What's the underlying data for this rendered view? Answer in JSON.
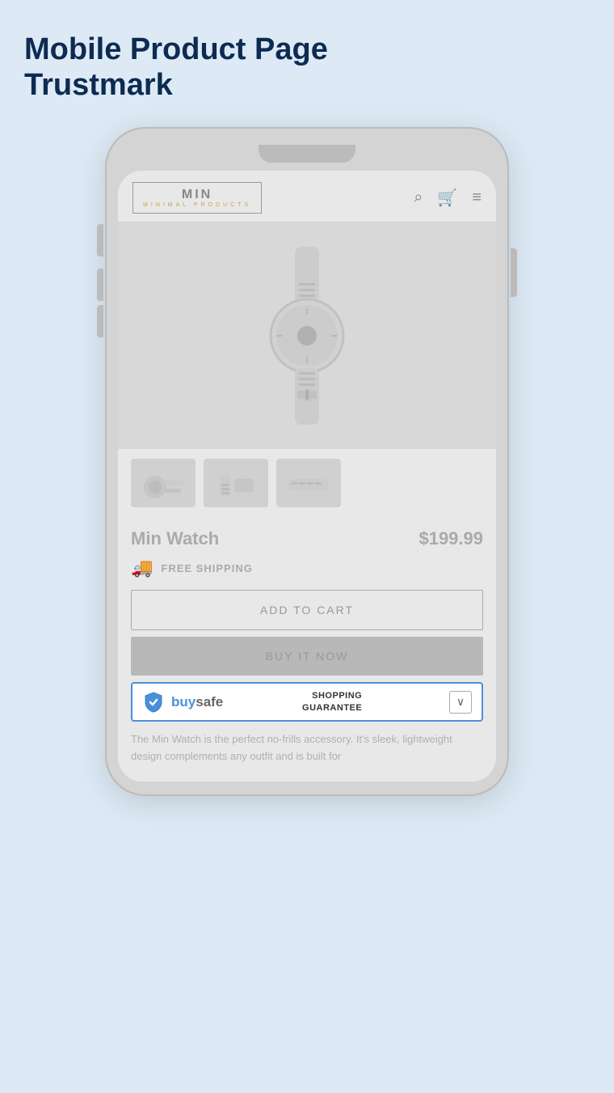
{
  "page": {
    "title_line1": "Mobile Product Page",
    "title_line2": "Trustmark"
  },
  "navbar": {
    "brand_name": "MIN",
    "brand_sub": "MINIMAL PRODUCTS",
    "search_icon": "⌕",
    "cart_icon": "🛒",
    "menu_icon": "≡"
  },
  "product": {
    "name": "Min Watch",
    "price": "$199.99",
    "shipping_label": "FREE SHIPPING",
    "add_to_cart_label": "ADD TO CART",
    "buy_now_label": "BUY IT NOW",
    "description": "The Min Watch is the perfect no-frills accessory. It's sleek, lightweight design complements any outfit and is built for"
  },
  "buysafe": {
    "logo_blue": "buy",
    "logo_gray": "safe",
    "guarantee_line1": "SHOPPING",
    "guarantee_line2": "GUARANTEE",
    "chevron": "∨"
  }
}
